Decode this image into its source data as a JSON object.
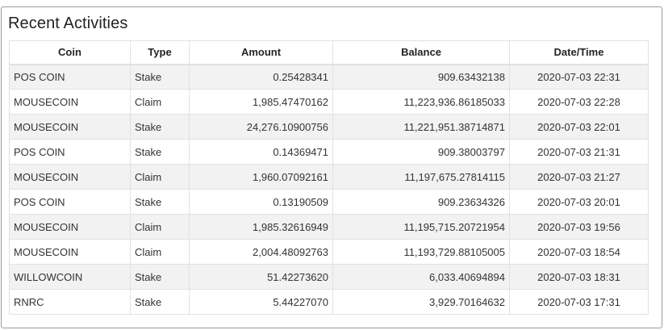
{
  "panel": {
    "title": "Recent Activities"
  },
  "table": {
    "headers": [
      "Coin",
      "Type",
      "Amount",
      "Balance",
      "Date/Time"
    ],
    "rows": [
      [
        "POS COIN",
        "Stake",
        "0.25428341",
        "909.63432138",
        "2020-07-03 22:31"
      ],
      [
        "MOUSECOIN",
        "Claim",
        "1,985.47470162",
        "11,223,936.86185033",
        "2020-07-03 22:28"
      ],
      [
        "MOUSECOIN",
        "Stake",
        "24,276.10900756",
        "11,221,951.38714871",
        "2020-07-03 22:01"
      ],
      [
        "POS COIN",
        "Stake",
        "0.14369471",
        "909.38003797",
        "2020-07-03 21:31"
      ],
      [
        "MOUSECOIN",
        "Claim",
        "1,960.07092161",
        "11,197,675.27814115",
        "2020-07-03 21:27"
      ],
      [
        "POS COIN",
        "Stake",
        "0.13190509",
        "909.23634326",
        "2020-07-03 20:01"
      ],
      [
        "MOUSECOIN",
        "Claim",
        "1,985.32616949",
        "11,195,715.20721954",
        "2020-07-03 19:56"
      ],
      [
        "MOUSECOIN",
        "Claim",
        "2,004.48092763",
        "11,193,729.88105005",
        "2020-07-03 18:54"
      ],
      [
        "WILLOWCOIN",
        "Stake",
        "51.42273620",
        "6,033.40694894",
        "2020-07-03 18:31"
      ],
      [
        "RNRC",
        "Stake",
        "5.44227070",
        "3,929.70164632",
        "2020-07-03 17:31"
      ]
    ]
  }
}
